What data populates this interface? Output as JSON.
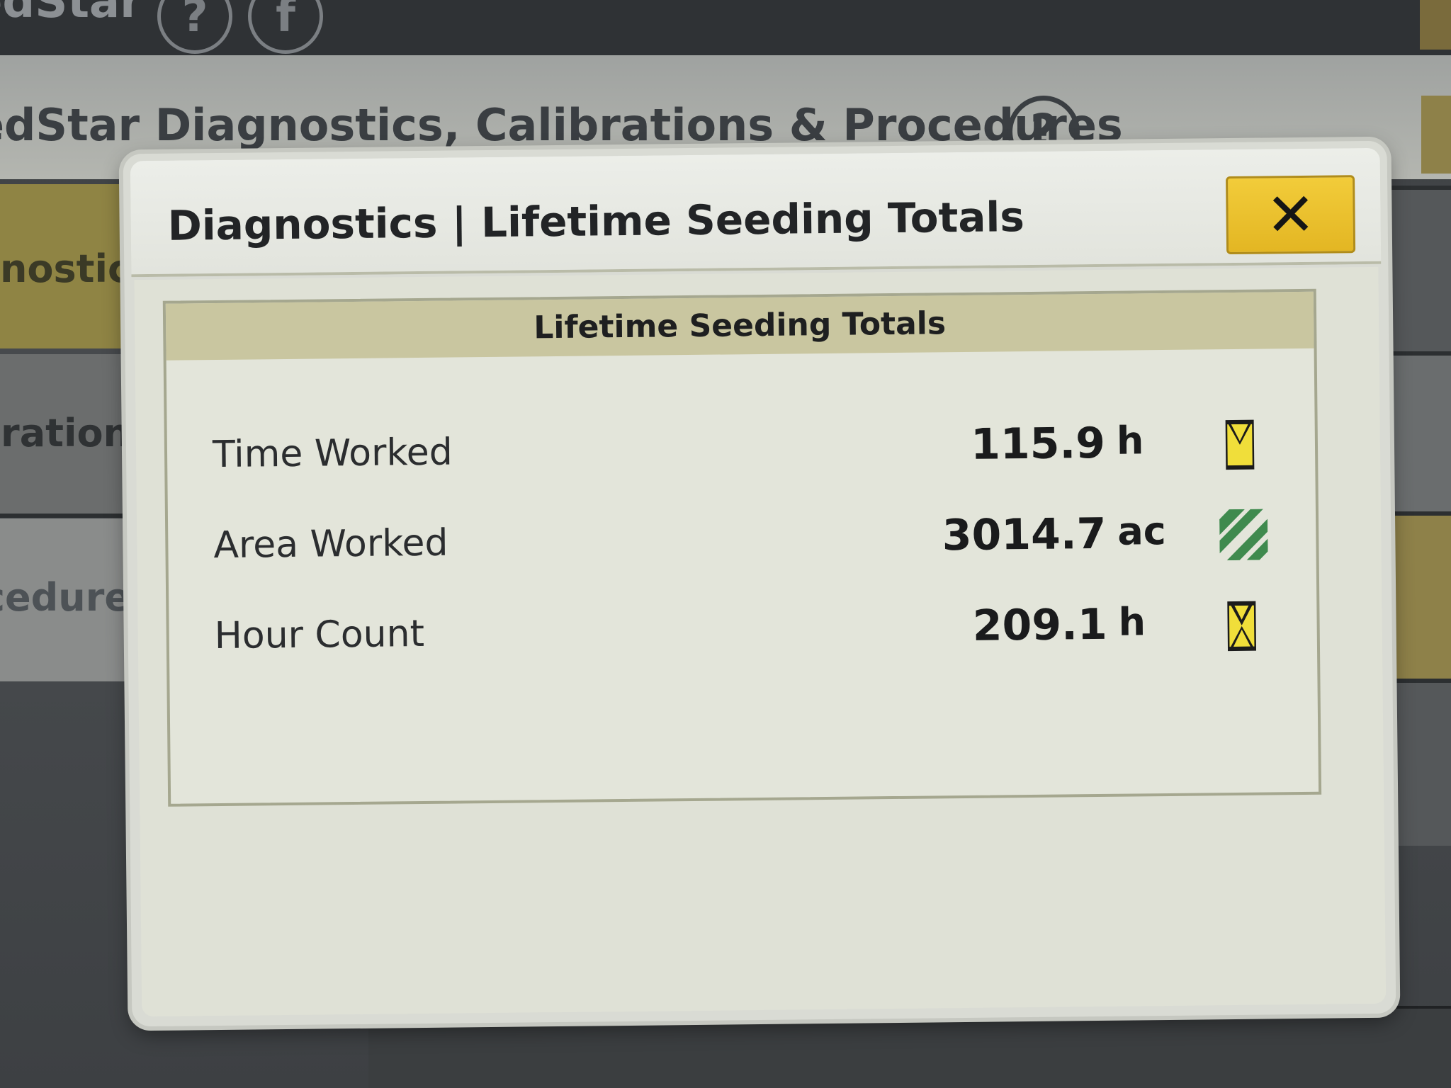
{
  "topbar": {
    "title": "edStar",
    "help_glyph": "?",
    "info_glyph": "f"
  },
  "page": {
    "title": "edStar Diagnostics, Calibrations & Procedures",
    "help_glyph": "?"
  },
  "nav": {
    "items": [
      {
        "label": "gnostic"
      },
      {
        "label": "bration"
      },
      {
        "label": "cedure"
      }
    ]
  },
  "dialog": {
    "title": "Diagnostics | Lifetime Seeding Totals",
    "close_glyph": "✕",
    "panel": {
      "header": "Lifetime Seeding Totals",
      "rows": [
        {
          "label": "Time Worked",
          "value": "115.9",
          "unit": "h",
          "icon": "hourglass-icon"
        },
        {
          "label": "Area Worked",
          "value": "3014.7",
          "unit": "ac",
          "icon": "area-hatch-icon"
        },
        {
          "label": "Hour Count",
          "value": "209.1",
          "unit": "h",
          "icon": "hourglass-icon"
        }
      ]
    }
  },
  "colors": {
    "accent_yellow": "#e8bc2a",
    "header_band": "#c9c6a0",
    "area_green": "#3f8a4e",
    "dialog_bg": "#dfe1d6"
  }
}
